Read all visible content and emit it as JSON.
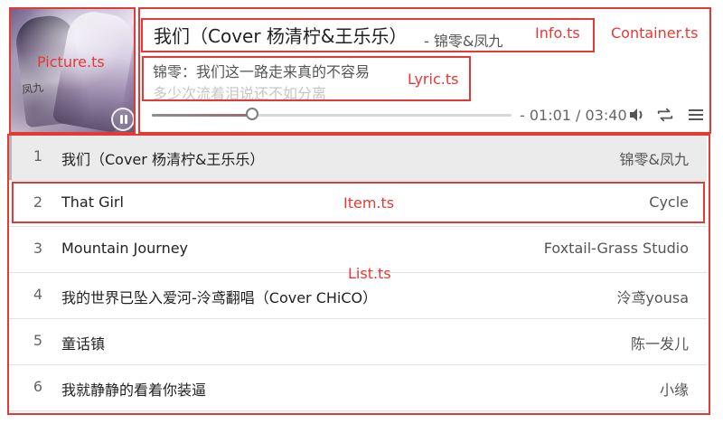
{
  "player": {
    "title": "我们（Cover 杨清柠&王乐乐）",
    "artist": "- 锦零&凤九",
    "lyric_current": "锦零：我们这一路走来真的不容易",
    "lyric_next": "多少次流着泪说还不如分离",
    "time": "- 01:01 / 03:40",
    "progress_ratio": 0.28
  },
  "annotations": {
    "picture": "Picture.ts",
    "info": "Info.ts",
    "container": "Container.ts",
    "lyric": "Lyric.ts",
    "item": "Item.ts",
    "list": "List.ts"
  },
  "playlist": {
    "rows": [
      {
        "index": "1",
        "title": "我们（Cover 杨清柠&王乐乐）",
        "artist": "锦零&凤九",
        "active": true
      },
      {
        "index": "2",
        "title": "That Girl",
        "artist": "Cycle",
        "active": false
      },
      {
        "index": "3",
        "title": "Mountain Journey",
        "artist": "Foxtail-Grass Studio",
        "active": false
      },
      {
        "index": "4",
        "title": "我的世界已坠入爱河-泠鸢翻唱（Cover CHiCO）",
        "artist": "泠鸢yousa",
        "active": false
      },
      {
        "index": "5",
        "title": "童话镇",
        "artist": "陈一发儿",
        "active": false
      },
      {
        "index": "6",
        "title": "我就静静的看着你装逼",
        "artist": "小缘",
        "active": false
      }
    ]
  },
  "icons": {
    "pause": "pause-icon",
    "volume": "volume-icon",
    "loop": "loop-icon",
    "menu": "menu-icon"
  },
  "colors": {
    "annotation": "#e53935",
    "active_row": "#ebebeb",
    "progress_knob": "#7d7d7d"
  }
}
